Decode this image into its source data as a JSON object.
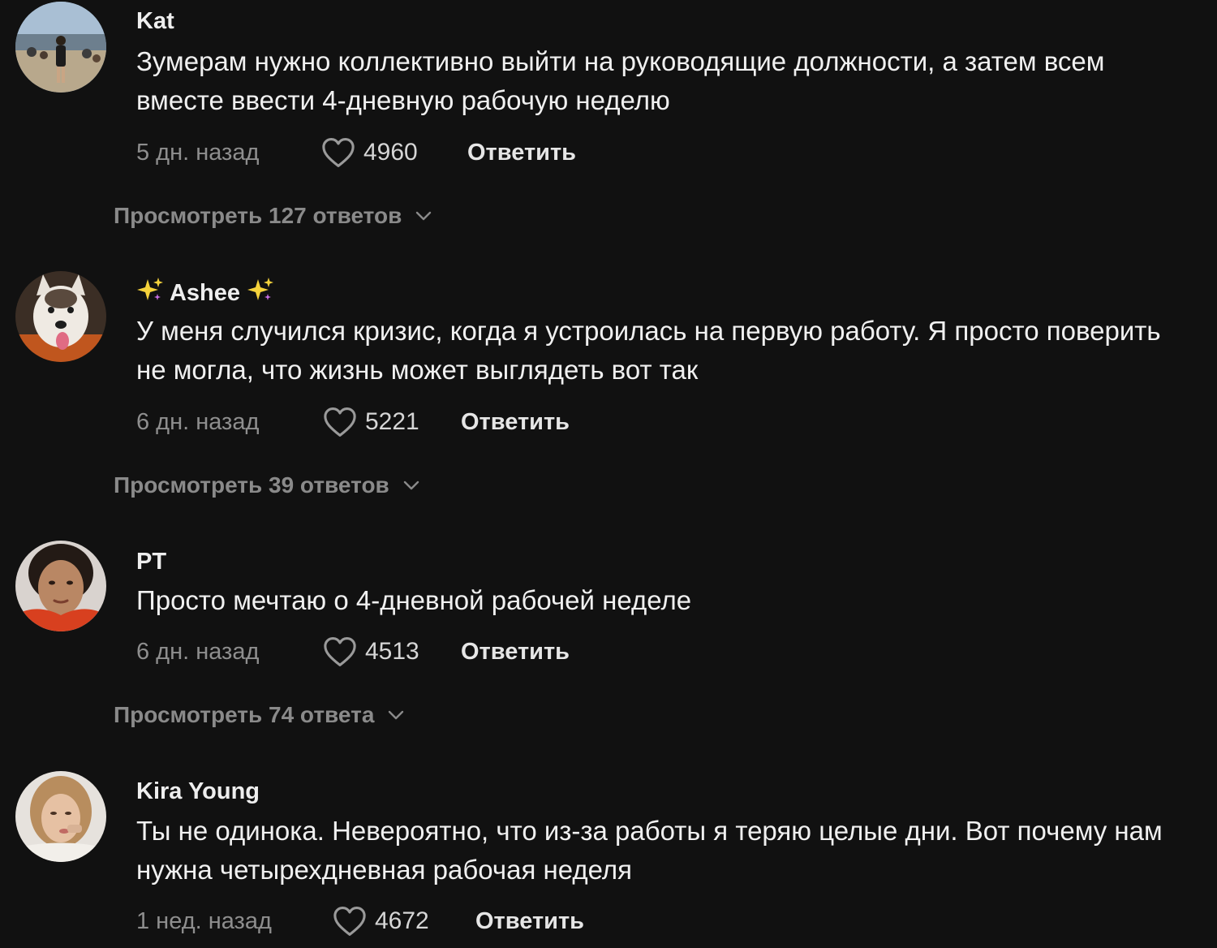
{
  "colors": {
    "background": "#111111",
    "text_primary": "#f0f0f0",
    "text_muted": "#8e8e8e",
    "view_replies": "#8a8a8a"
  },
  "comments": [
    {
      "username": "Kat",
      "text": "Зумерам нужно коллективно выйти на руководящие должности, а затем всем вместе ввести 4-дневную рабочую неделю",
      "time": "5 дн. назад",
      "likes": "4960",
      "reply_label": "Ответить",
      "view_replies_label": "Просмотреть 127 ответов",
      "avatar_icon": "avatar-photo-festival-crowd"
    },
    {
      "username": "Ashee",
      "username_decoration": "sparkles-icon",
      "text": "У меня случился кризис, когда я устроилась на первую работу. Я просто поверить не могла, что жизнь может выглядеть вот так",
      "time": "6 дн. назад",
      "likes": "5221",
      "reply_label": "Ответить",
      "view_replies_label": "Просмотреть 39 ответов",
      "avatar_icon": "avatar-photo-dog"
    },
    {
      "username": "PT",
      "text": "Просто мечтаю о 4-дневной рабочей неделе",
      "time": "6 дн. назад",
      "likes": "4513",
      "reply_label": "Ответить",
      "view_replies_label": "Просмотреть 74 ответа",
      "avatar_icon": "avatar-photo-woman"
    },
    {
      "username": "Kira Young",
      "text": "Ты не одинока. Невероятно, что из-за работы я теряю целые дни. Вот почему нам нужна четырехдневная рабочая неделя",
      "time": "1 нед. назад",
      "likes": "4672",
      "reply_label": "Ответить",
      "avatar_icon": "avatar-photo-woman-blonde"
    }
  ]
}
